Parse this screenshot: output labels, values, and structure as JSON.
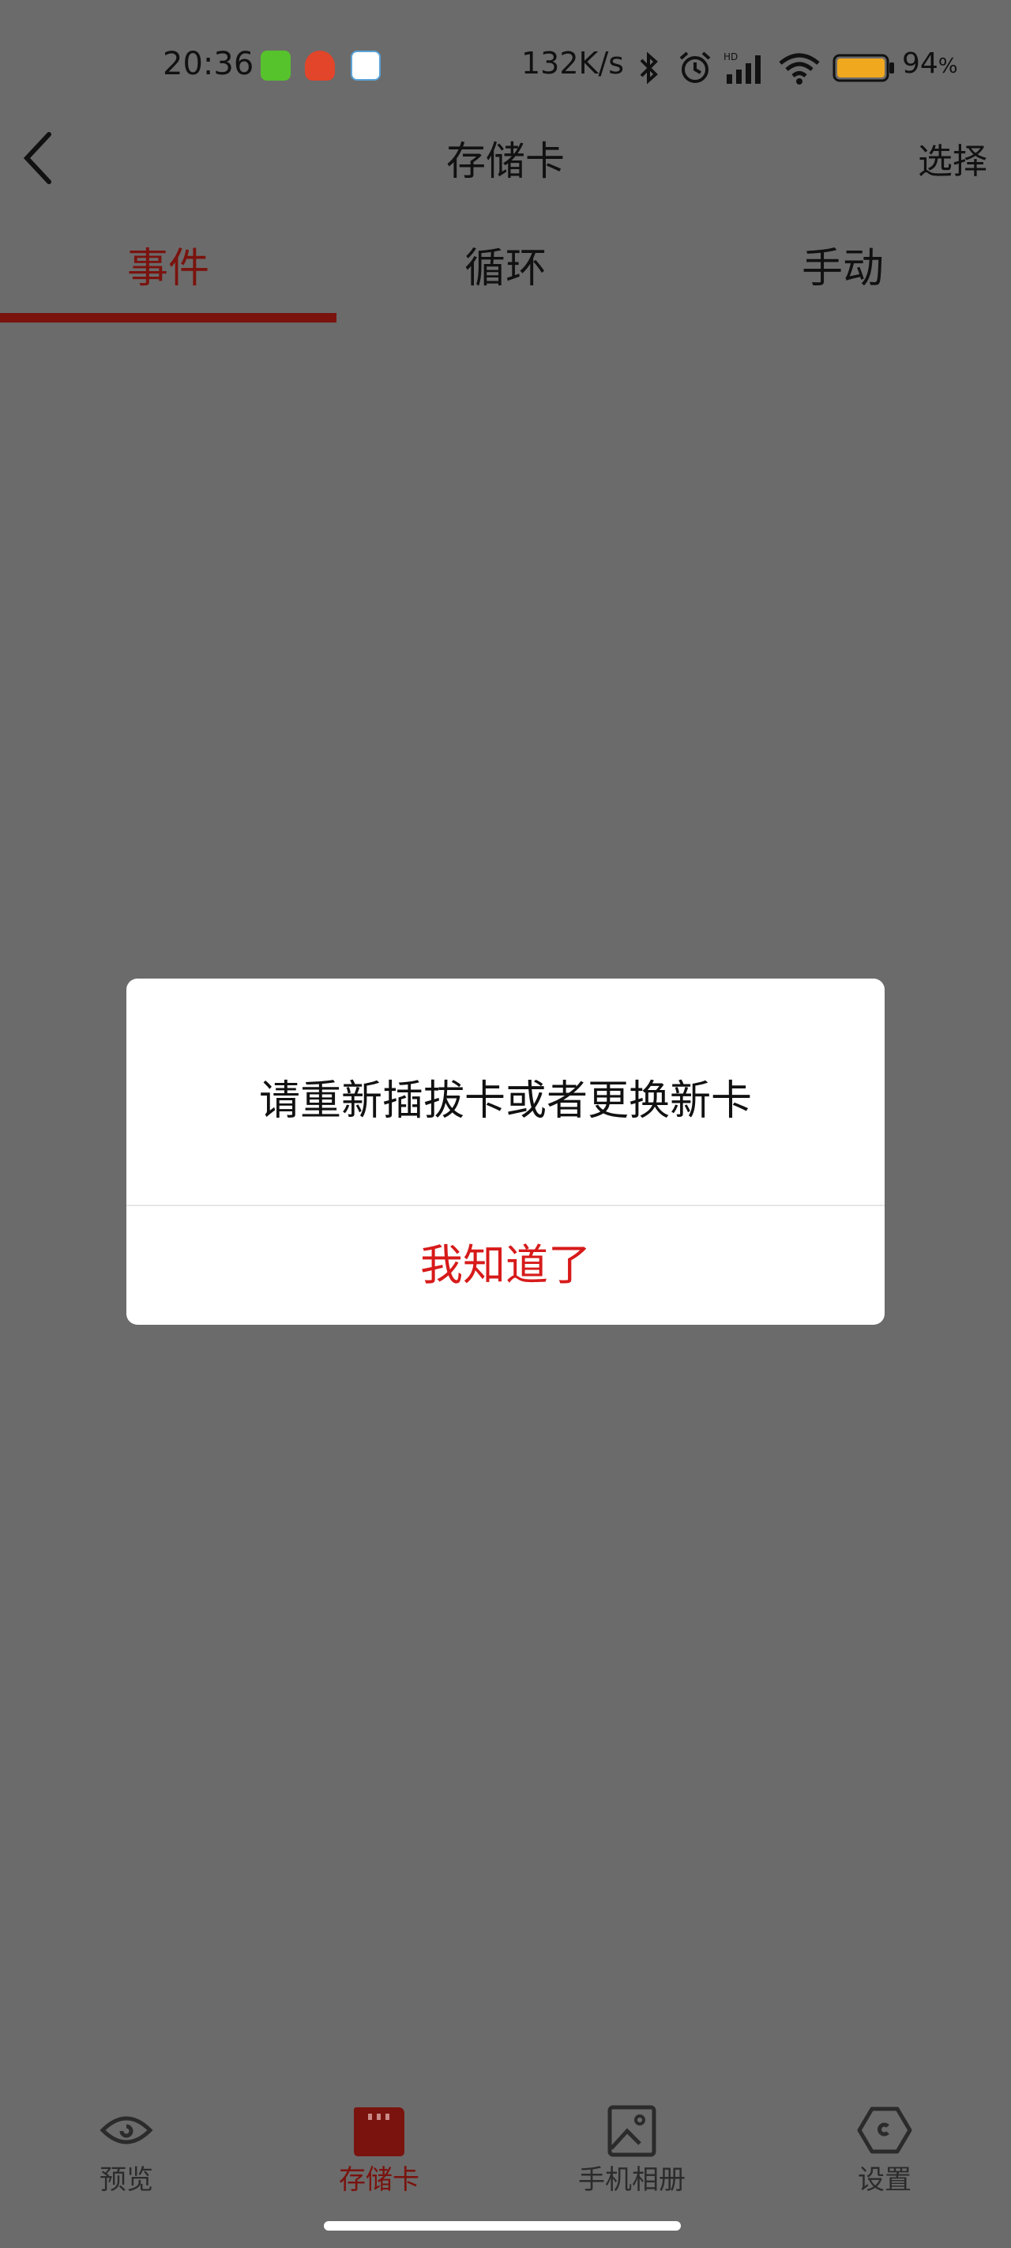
{
  "status_bar": {
    "time": "20:36",
    "speed": "132K/s",
    "battery_percent": "94",
    "battery_unit": "%",
    "icons": [
      "bluetooth-icon",
      "alarm-icon",
      "hd-signal-icon",
      "wifi-icon",
      "battery-icon"
    ]
  },
  "header": {
    "title": "存储卡",
    "select_label": "选择"
  },
  "tabs": [
    {
      "label": "事件",
      "active": true
    },
    {
      "label": "循环",
      "active": false
    },
    {
      "label": "手动",
      "active": false
    }
  ],
  "dialog": {
    "message": "请重新插拔卡或者更换新卡",
    "confirm_label": "我知道了"
  },
  "bottom_nav": [
    {
      "label": "预览",
      "icon": "eye-icon",
      "active": false
    },
    {
      "label": "存储卡",
      "icon": "sd-card-icon",
      "active": true
    },
    {
      "label": "手机相册",
      "icon": "image-icon",
      "active": false
    },
    {
      "label": "设置",
      "icon": "settings-hexagon-icon",
      "active": false
    }
  ],
  "colors": {
    "accent": "#7a130e",
    "dialog_button": "#d71a1a",
    "overlay": "#6b6b6b"
  }
}
